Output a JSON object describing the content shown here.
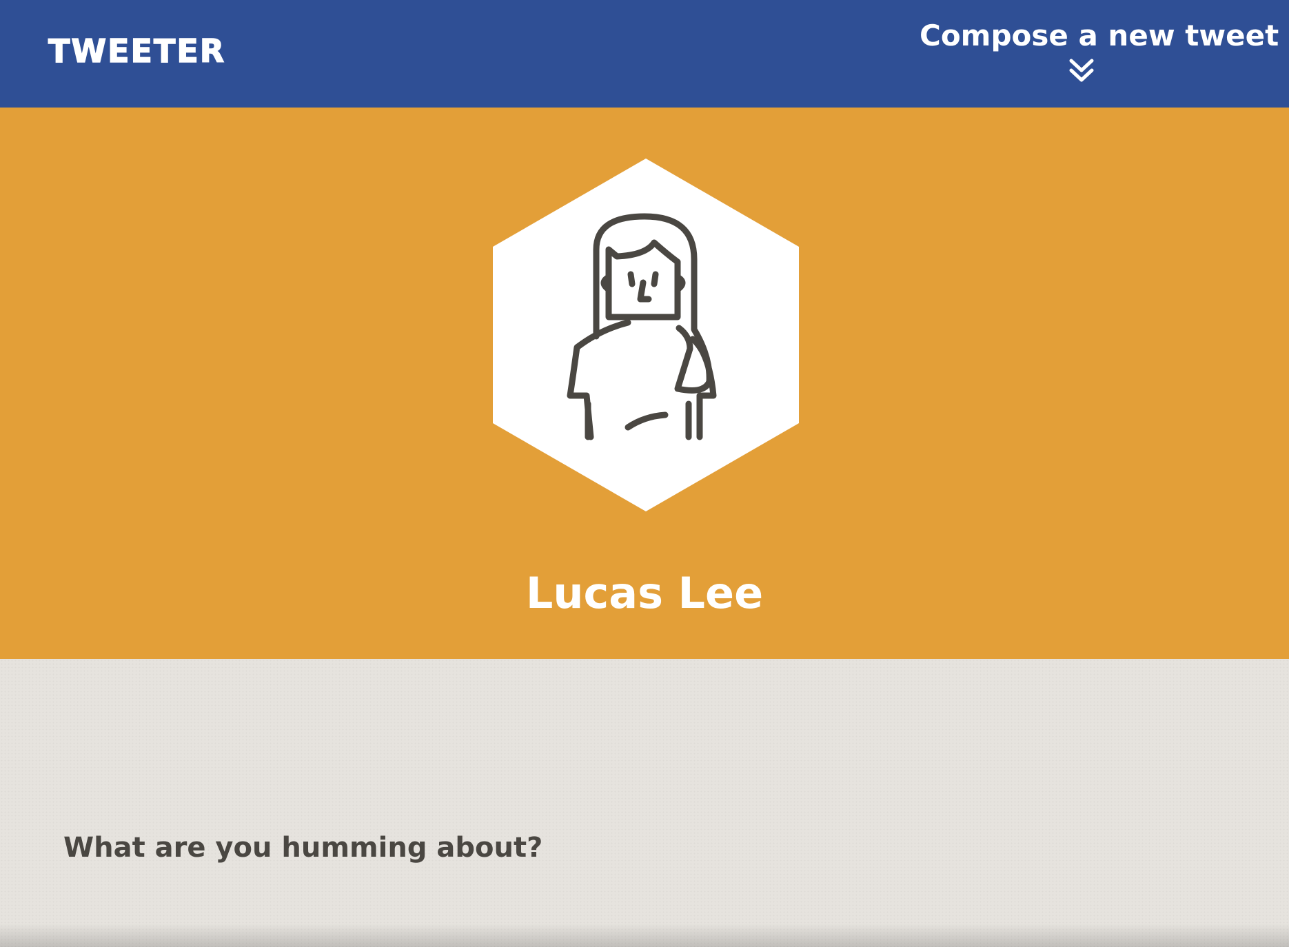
{
  "app": {
    "logo_text": "TWEETER"
  },
  "nav": {
    "compose_label": "Compose a new tweet",
    "compose_icon": "double-chevron-down-icon"
  },
  "profile": {
    "name": "Lucas Lee",
    "avatar_icon": "user-avatar-icon"
  },
  "compose": {
    "prompt": "What are you humming about?"
  },
  "colors": {
    "navbar": "#2f4f95",
    "profile_header": "#e39f38",
    "compose_background": "#e6e3de",
    "avatar_background": "#ffffff",
    "avatar_line": "#4a4742",
    "text_light": "#ffffff",
    "text_dark": "#4a4742"
  }
}
